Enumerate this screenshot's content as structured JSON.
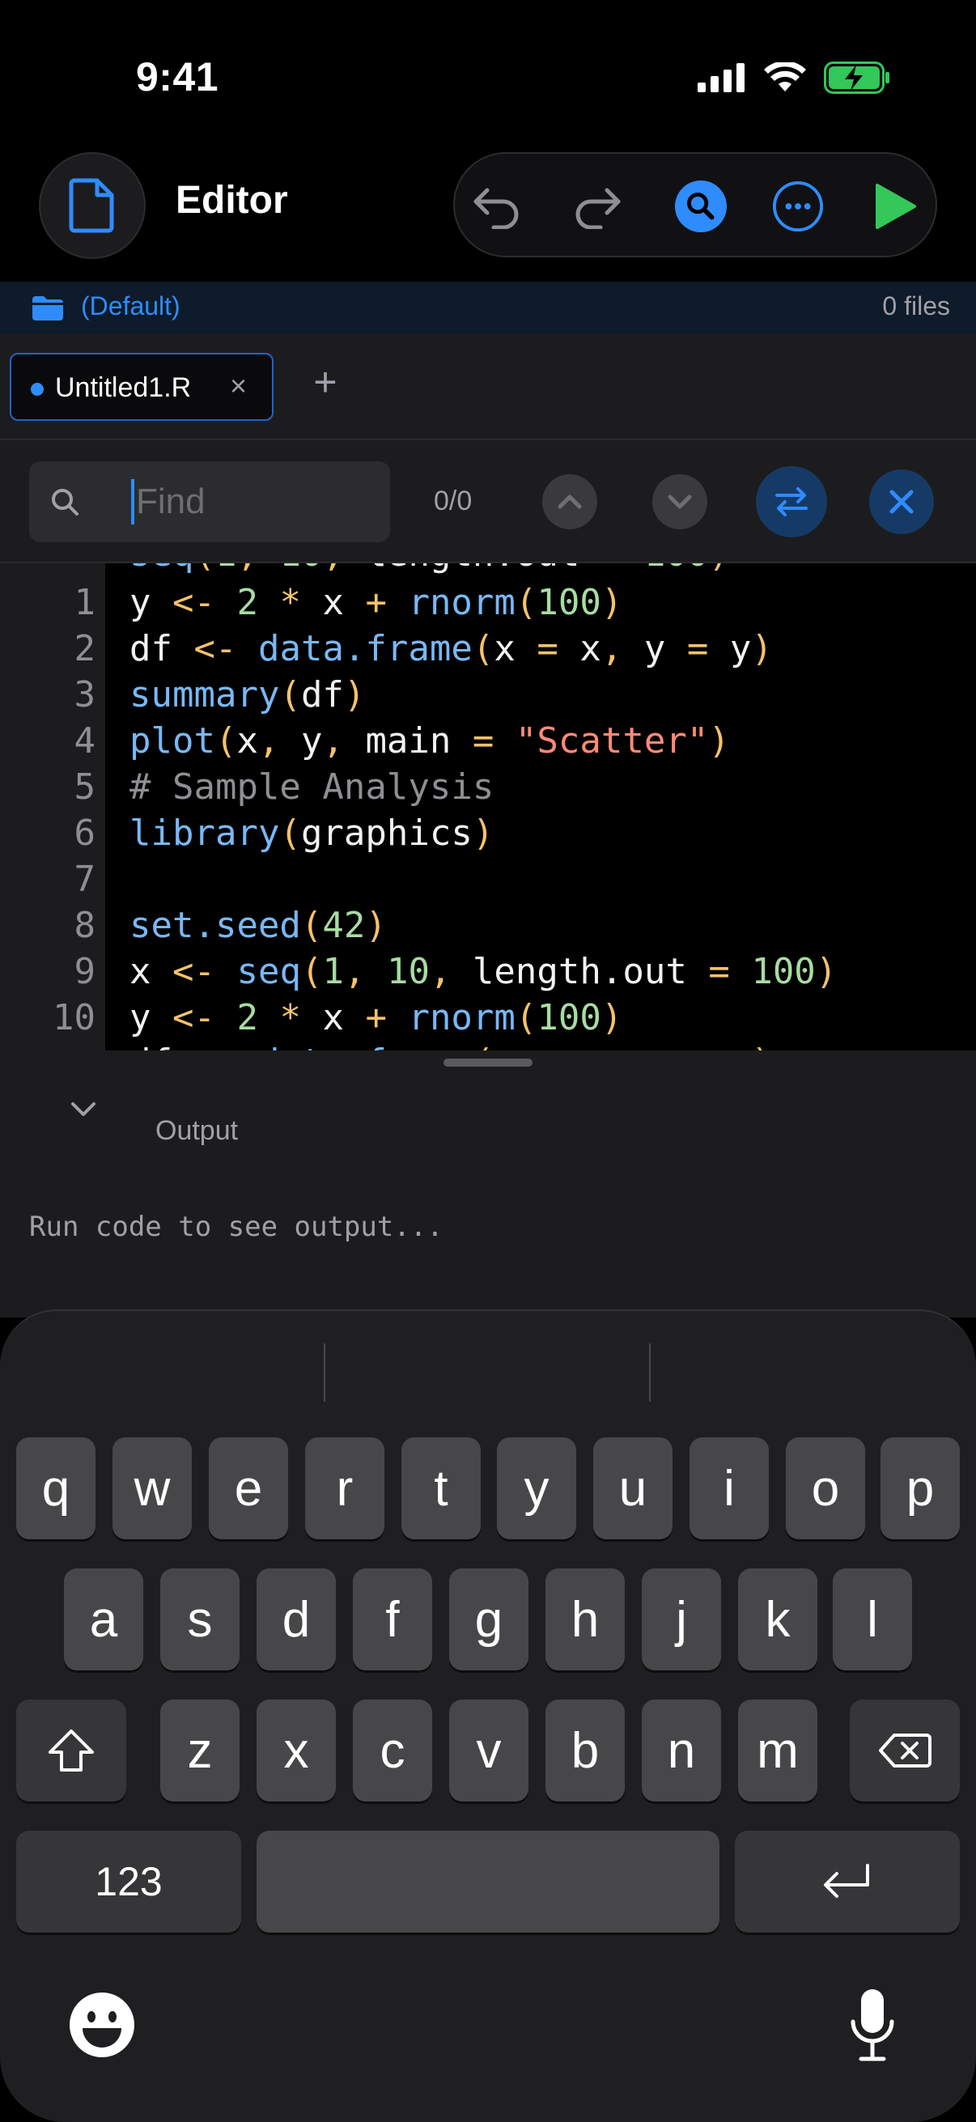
{
  "status_bar": {
    "time": "9:41"
  },
  "header": {
    "title": "Editor",
    "icons": [
      "file-icon",
      "undo-icon",
      "redo-icon",
      "search-icon",
      "more-icon",
      "run-icon"
    ]
  },
  "project": {
    "name": "(Default)",
    "file_count": "0 files"
  },
  "tabs": [
    {
      "label": "Untitled1.R",
      "close": "×"
    }
  ],
  "tab_add": "+",
  "find": {
    "placeholder": "Find",
    "count": "0/0"
  },
  "code": {
    "lines": [
      {
        "num": "1",
        "text": "y <- 2 * x + rnorm(100)"
      },
      {
        "num": "2",
        "text": "df <- data.frame(x = x, y = y)"
      },
      {
        "num": "3",
        "text": "summary(df)"
      },
      {
        "num": "4",
        "text": "plot(x, y, main = \"Scatter\")"
      },
      {
        "num": "5",
        "text": "# Sample Analysis"
      },
      {
        "num": "6",
        "text": "library(graphics)"
      },
      {
        "num": "7",
        "text": ""
      },
      {
        "num": "8",
        "text": "set.seed(42)"
      },
      {
        "num": "9",
        "text": "x <- seq(1, 10, length.out = 100)"
      },
      {
        "num": "10",
        "text": "y <- 2 * x + rnorm(100)"
      }
    ]
  },
  "output": {
    "title": "Output",
    "placeholder": "Run code to see output..."
  },
  "keyboard": {
    "row1": [
      "q",
      "w",
      "e",
      "r",
      "t",
      "y",
      "u",
      "i",
      "o",
      "p"
    ],
    "row2": [
      "a",
      "s",
      "d",
      "f",
      "g",
      "h",
      "j",
      "k",
      "l"
    ],
    "row3": [
      "z",
      "x",
      "c",
      "v",
      "b",
      "n",
      "m"
    ],
    "numbers_label": "123"
  },
  "colors": {
    "accent": "#2f8cff",
    "run": "#34c759",
    "background": "#000000",
    "panel": "#1c1c1e"
  }
}
